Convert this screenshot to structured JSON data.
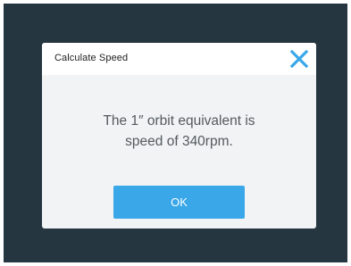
{
  "dialog": {
    "title": "Calculate Speed",
    "message_line1": "The 1″ orbit equivalent is",
    "message_line2": "speed of 340rpm.",
    "ok_label": "OK",
    "close_icon": "close-icon"
  },
  "colors": {
    "backdrop": "#263640",
    "dialog_body": "#f1f3f4",
    "dialog_header": "#ffffff",
    "accent": "#3aa7e8",
    "message_text": "#555a5e"
  }
}
